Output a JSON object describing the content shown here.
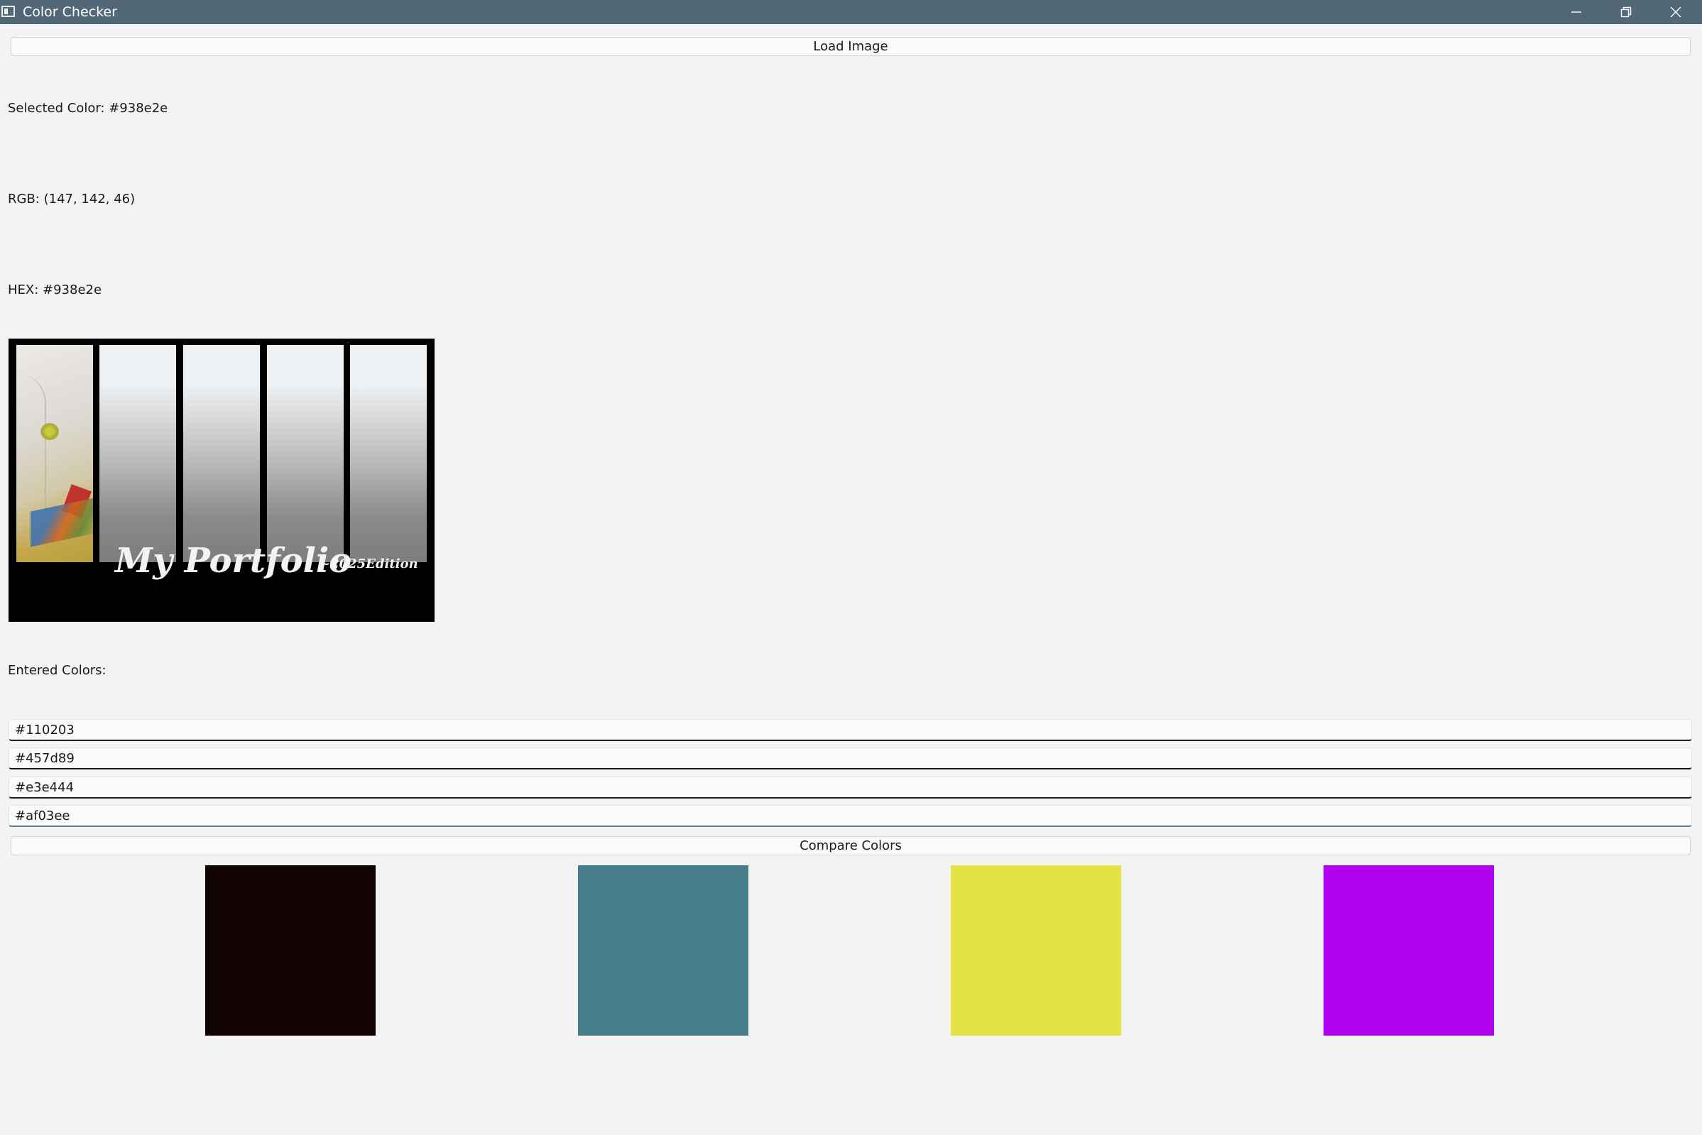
{
  "window": {
    "title": "Color Checker",
    "title_bar_color": "#526876"
  },
  "toolbar": {
    "load_label": "Load Image"
  },
  "info": {
    "selected_color": "Selected Color: #938e2e",
    "rgb": "RGB: (147, 142, 46)",
    "hex": "HEX: #938e2e"
  },
  "preview_image": {
    "title": "My Portfolio",
    "edition": "~2025Edition"
  },
  "entered": {
    "label": "Entered Colors:",
    "inputs": [
      {
        "value": "#110203"
      },
      {
        "value": "#457d89"
      },
      {
        "value": "#e3e444"
      },
      {
        "value": "#af03ee"
      }
    ]
  },
  "compare": {
    "label": "Compare Colors"
  },
  "swatches": [
    {
      "color": "#110203"
    },
    {
      "color": "#457d89"
    },
    {
      "color": "#e3e444"
    },
    {
      "color": "#af03ee"
    }
  ]
}
